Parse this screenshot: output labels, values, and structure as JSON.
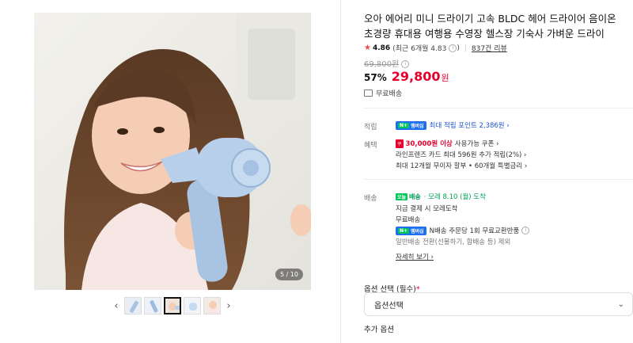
{
  "product": {
    "title": "오아 에어리 미니 드라이기 고속 BLDC 헤어 드라이어 음이온 초경량 휴대용 여행용 수영장 헬스장 기숙사 가벼운 드라이",
    "rating": "4.86",
    "rating_recent": "(최근 6개월 4.83",
    "review_count": "837건 리뷰",
    "original_price": "69,800원",
    "discount": "57%",
    "price": "29,800",
    "currency": "원",
    "shipping_free": "무료배송"
  },
  "gallery": {
    "counter": "5 / 10",
    "prev": "‹",
    "next": "›"
  },
  "points": {
    "label": "적립",
    "npay": "N+",
    "npay_text": "멤버십",
    "text": "최대 적립 포인트 2,386원 ›"
  },
  "benefits": {
    "label": "혜택",
    "coupon_badge": "쿠",
    "coupon_amount": "30,000원 이상",
    "coupon_text": "사용가능 쿠폰 ›",
    "card_text": "라인프렌즈 카드 최대 596원 추가 적립(2%) ›",
    "installment_text": "최대 12개월 무이자 할부 • 60개월 특별금리 ›"
  },
  "delivery": {
    "label": "배송",
    "today_box": "오늘",
    "today_text": "배송",
    "eta": "· 모레 8.10 (월) 도착",
    "order_now": "지금 결제 시 모레도착",
    "free": "무료배송",
    "return_text": "N배송 주문당 1회 무료교환반품",
    "exclude_text": "일반배송 전환(선물하기, 합배송 등) 제외",
    "more": "자세히 보기 ›"
  },
  "options": {
    "label": "옵션 선택 (필수)",
    "required_mark": "*",
    "placeholder": "옵션선택",
    "additional_label": "추가 옵션"
  },
  "colors": {
    "accent_red": "#e4002b",
    "npay_blue": "#1e6ff1",
    "naver_green": "#03c75a"
  }
}
